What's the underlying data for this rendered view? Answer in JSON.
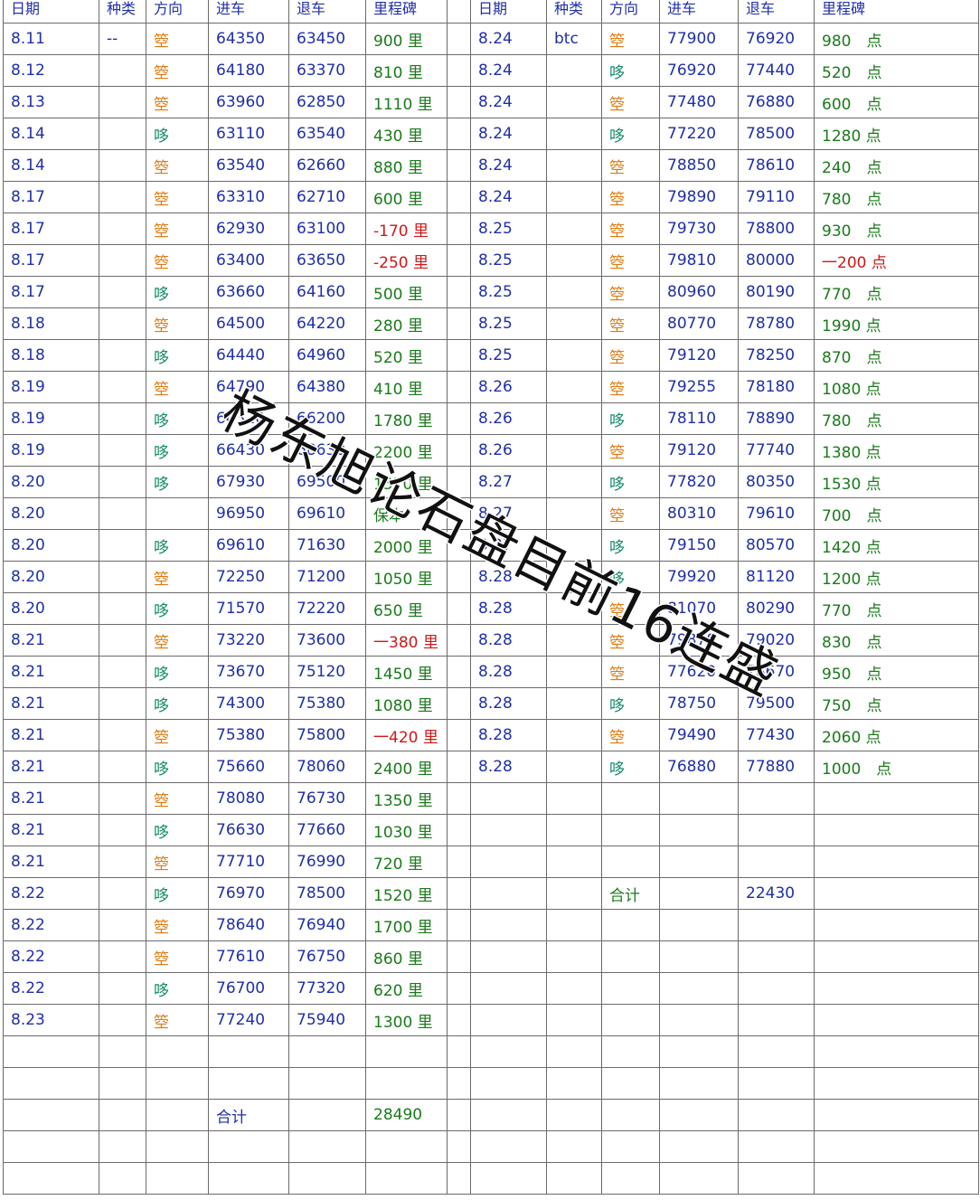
{
  "headers": [
    "日期",
    "种类",
    "方向",
    "进车",
    "退车",
    "里程碑",
    "日期",
    "种类",
    "方向",
    "进车",
    "退车",
    "里程碑"
  ],
  "left_rows": [
    [
      "8.11",
      "--",
      "箜",
      "64350",
      "63450",
      "900 里"
    ],
    [
      "8.12",
      "",
      "箜",
      "64180",
      "63370",
      "810 里"
    ],
    [
      "8.13",
      "",
      "箜",
      "63960",
      "62850",
      "1110 里"
    ],
    [
      "8.14",
      "",
      "哆",
      "63110",
      "63540",
      "430 里"
    ],
    [
      "8.14",
      "",
      "箜",
      "63540",
      "62660",
      "880 里"
    ],
    [
      "8.17",
      "",
      "箜",
      "63310",
      "62710",
      "600 里"
    ],
    [
      "8.17",
      "",
      "箜",
      "62930",
      "63100",
      "-170 里"
    ],
    [
      "8.17",
      "",
      "箜",
      "63400",
      "63650",
      "-250 里"
    ],
    [
      "8.17",
      "",
      "哆",
      "63660",
      "64160",
      "500 里"
    ],
    [
      "8.18",
      "",
      "箜",
      "64500",
      "64220",
      "280 里"
    ],
    [
      "8.18",
      "",
      "哆",
      "64440",
      "64960",
      "520 里"
    ],
    [
      "8.19",
      "",
      "箜",
      "64790",
      "64380",
      "410 里"
    ],
    [
      "8.19",
      "",
      "哆",
      "64320",
      "66200",
      "1780 里"
    ],
    [
      "8.19",
      "",
      "哆",
      "66430",
      "68630",
      "2200 里"
    ],
    [
      "8.20",
      "",
      "哆",
      "67930",
      "69500",
      "1570 里"
    ],
    [
      "8.20",
      "",
      "",
      "96950",
      "69610",
      "保本"
    ],
    [
      "8.20",
      "",
      "哆",
      "69610",
      "71630",
      "2000 里"
    ],
    [
      "8.20",
      "",
      "箜",
      "72250",
      "71200",
      "1050 里"
    ],
    [
      "8.20",
      "",
      "哆",
      "71570",
      "72220",
      "650 里"
    ],
    [
      "8.21",
      "",
      "箜",
      "73220",
      "73600",
      "一380 里"
    ],
    [
      "8.21",
      "",
      "哆",
      "73670",
      "75120",
      "1450 里"
    ],
    [
      "8.21",
      "",
      "哆",
      "74300",
      "75380",
      "1080 里"
    ],
    [
      "8.21",
      "",
      "箜",
      "75380",
      "75800",
      "一420 里"
    ],
    [
      "8.21",
      "",
      "哆",
      "75660",
      "78060",
      "2400 里"
    ],
    [
      "8.21",
      "",
      "箜",
      "78080",
      "76730",
      "1350 里"
    ],
    [
      "8.21",
      "",
      "哆",
      "76630",
      "77660",
      "1030 里"
    ],
    [
      "8.21",
      "",
      "箜",
      "77710",
      "76990",
      "720 里"
    ],
    [
      "8.22",
      "",
      "哆",
      "76970",
      "78500",
      "1520 里"
    ],
    [
      "8.22",
      "",
      "箜",
      "78640",
      "76940",
      "1700 里"
    ],
    [
      "8.22",
      "",
      "箜",
      "77610",
      "76750",
      "860 里"
    ],
    [
      "8.22",
      "",
      "哆",
      "76700",
      "77320",
      "620 里"
    ],
    [
      "8.23",
      "",
      "箜",
      "77240",
      "75940",
      "1300 里"
    ]
  ],
  "right_rows": [
    [
      "8.24",
      "btc",
      "箜",
      "77900",
      "76920",
      "980　点"
    ],
    [
      "8.24",
      "",
      "哆",
      "76920",
      "77440",
      "520　点"
    ],
    [
      "8.24",
      "",
      "箜",
      "77480",
      "76880",
      "600　点"
    ],
    [
      "8.24",
      "",
      "哆",
      "77220",
      "78500",
      "1280 点"
    ],
    [
      "8.24",
      "",
      "箜",
      "78850",
      "78610",
      "240　点"
    ],
    [
      "8.24",
      "",
      "箜",
      "79890",
      "79110",
      "780　点"
    ],
    [
      "8.25",
      "",
      "箜",
      "79730",
      "78800",
      "930　点"
    ],
    [
      "8.25",
      "",
      "箜",
      "79810",
      "80000",
      "一200 点"
    ],
    [
      "8.25",
      "",
      "箜",
      "80960",
      "80190",
      "770　点"
    ],
    [
      "8.25",
      "",
      "箜",
      "80770",
      "78780",
      "1990 点"
    ],
    [
      "8.25",
      "",
      "箜",
      "79120",
      "78250",
      "870　点"
    ],
    [
      "8.26",
      "",
      "箜",
      "79255",
      "78180",
      "1080 点"
    ],
    [
      "8.26",
      "",
      "哆",
      "78110",
      "78890",
      "780　点"
    ],
    [
      "8.26",
      "",
      "箜",
      "79120",
      "77740",
      "1380 点"
    ],
    [
      "8.27",
      "",
      "哆",
      "77820",
      "80350",
      "1530 点"
    ],
    [
      "8.27",
      "",
      "箜",
      "80310",
      "79610",
      "700　点"
    ],
    [
      "8.27",
      "",
      "哆",
      "79150",
      "80570",
      "1420 点"
    ],
    [
      "8.28",
      "",
      "哆",
      "79920",
      "81120",
      "1200 点"
    ],
    [
      "8.28",
      "",
      "箜",
      "81070",
      "80290",
      "770　点"
    ],
    [
      "8.28",
      "",
      "箜",
      "79870",
      "79020",
      "830　点"
    ],
    [
      "8.28",
      "",
      "箜",
      "77620",
      "78670",
      "950　点"
    ],
    [
      "8.28",
      "",
      "哆",
      "78750",
      "79500",
      "750　点"
    ],
    [
      "8.28",
      "",
      "箜",
      "79490",
      "77430",
      "2060 点"
    ],
    [
      "8.28",
      "",
      "哆",
      "76880",
      "77880",
      "1000　点"
    ]
  ],
  "right_total": {
    "label": "合计",
    "value": "22430"
  },
  "left_total": {
    "label": "合计",
    "value": "28490"
  },
  "watermark": "杨东旭论石盘目前16连盛",
  "colors": {
    "blue": "#1f2fa8",
    "green": "#1a7a1a",
    "red": "#d01818",
    "orange": "#e07a10",
    "teal": "#148a6a"
  }
}
